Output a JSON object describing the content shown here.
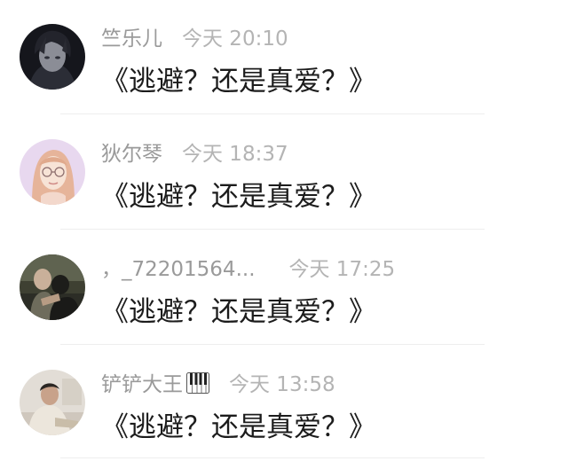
{
  "comments": [
    {
      "name": "竺乐儿",
      "time": "今天 20:10",
      "message": "《逃避？还是真爱？》",
      "avatar": "dark-anime-boy-avatar"
    },
    {
      "name": "狄尔琴",
      "time": "今天 18:37",
      "message": "《逃避？还是真爱？》",
      "avatar": "glasses-girl-avatar"
    },
    {
      "name": "，_72201564...",
      "time": "今天 17:25",
      "message": "《逃避？还是真爱？》",
      "avatar": "couple-photo-avatar"
    },
    {
      "name": "铲铲大王",
      "name_emoji": "piano-icon",
      "time": "今天 13:58",
      "message": "《逃避？还是真爱？》",
      "avatar": "sitting-person-photo-avatar"
    }
  ],
  "colors": {
    "name": "#9a9a9a",
    "time": "#b4b4b4",
    "message": "#1c1c1c",
    "divider": "#eeeeee"
  }
}
